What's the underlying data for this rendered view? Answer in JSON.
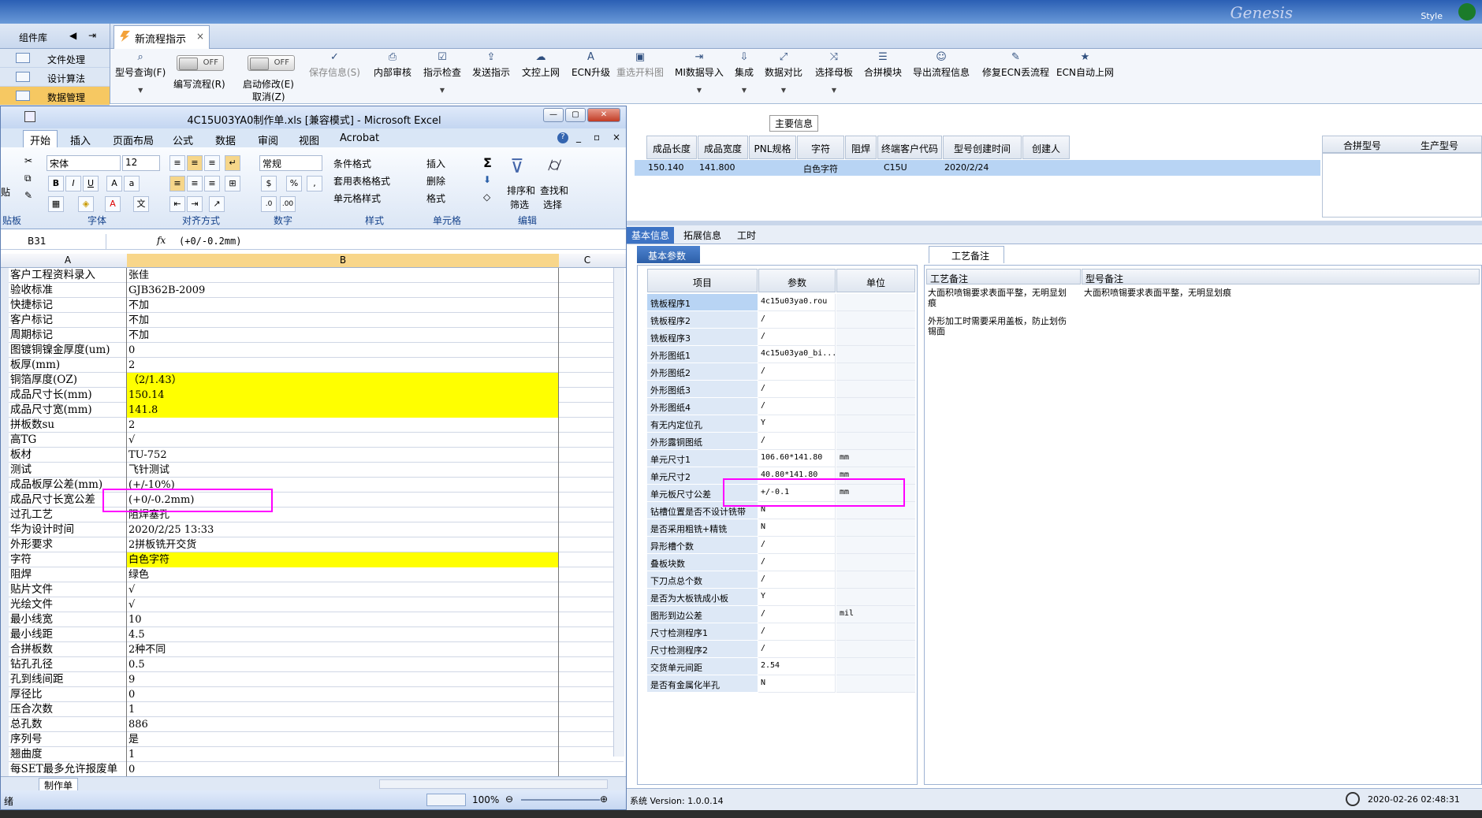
{
  "app": {
    "tab_title": "新流程指示",
    "close_glyph": "×",
    "style_label": "Style",
    "left_panel": {
      "title": "组件库",
      "items": [
        "文件处理",
        "设计算法",
        "数据管理"
      ]
    },
    "toolbar": {
      "buttons": [
        {
          "label": "型号查询(F)",
          "glyph": "⌕",
          "disabled": false
        },
        {
          "label": "保存信息(S)",
          "glyph": "✓",
          "disabled": true
        },
        {
          "label": "内部审核",
          "glyph": "⎙",
          "disabled": false
        },
        {
          "label": "指示检查",
          "glyph": "☑",
          "disabled": false
        },
        {
          "label": "发送指示",
          "glyph": "⇪",
          "disabled": false
        },
        {
          "label": "文控上网",
          "glyph": "☁",
          "disabled": false
        },
        {
          "label": "ECN升级",
          "glyph": "A",
          "disabled": false
        },
        {
          "label": "重选开料图",
          "glyph": "▣",
          "disabled": true
        },
        {
          "label": "MI数据导入",
          "glyph": "⇥",
          "disabled": false
        },
        {
          "label": "集成",
          "glyph": "⇩",
          "disabled": false
        },
        {
          "label": "数据对比",
          "glyph": "⤢",
          "disabled": false
        },
        {
          "label": "选择母板",
          "glyph": "⤨",
          "disabled": false
        },
        {
          "label": "合拼模块",
          "glyph": "☰",
          "disabled": false
        },
        {
          "label": "导出流程信息",
          "glyph": "☺",
          "disabled": false
        },
        {
          "label": "修复ECN丢流程",
          "glyph": "✎",
          "disabled": false
        },
        {
          "label": "ECN自动上网",
          "glyph": "★",
          "disabled": false
        }
      ],
      "toggle_off": "OFF",
      "toggle1_label": "编写流程(R)",
      "toggle2_label": "启动修改(E)",
      "toggle2_sub": "取消(Z)"
    },
    "main_info": {
      "title": "主要信息",
      "headers": [
        "成品长度",
        "成品宽度",
        "PNL规格",
        "字符",
        "阻焊",
        "终端客户代码",
        "型号创建时间",
        "创建人"
      ],
      "row": [
        "150.140",
        "141.800",
        "",
        "白色字符",
        "",
        "C15U",
        "2020/2/24",
        ""
      ],
      "right_headers": [
        "合拼型号",
        "生产型号"
      ]
    },
    "sub_tabs": [
      "基本信息",
      "拓展信息",
      "工时"
    ],
    "basic_params": {
      "tab": "基本参数",
      "headers": [
        "项目",
        "参数",
        "单位"
      ],
      "rows": [
        [
          "铣板程序1",
          "4c15u03ya0.rou",
          ""
        ],
        [
          "铣板程序2",
          "/",
          ""
        ],
        [
          "铣板程序3",
          "/",
          ""
        ],
        [
          "外形图纸1",
          "4c15u03ya0_bi...",
          ""
        ],
        [
          "外形图纸2",
          "/",
          ""
        ],
        [
          "外形图纸3",
          "/",
          ""
        ],
        [
          "外形图纸4",
          "/",
          ""
        ],
        [
          "有无内定位孔",
          "Y",
          ""
        ],
        [
          "外形露铜图纸",
          "/",
          ""
        ],
        [
          "单元尺寸1",
          "106.60*141.80",
          "mm"
        ],
        [
          "单元尺寸2",
          "40.80*141.80",
          "mm"
        ],
        [
          "单元板尺寸公差",
          "+/-0.1",
          "mm"
        ],
        [
          "钻槽位置是否不设计铣带",
          "N",
          ""
        ],
        [
          "是否采用粗铣+精铣",
          "N",
          ""
        ],
        [
          "异形槽个数",
          "/",
          ""
        ],
        [
          "叠板块数",
          "/",
          ""
        ],
        [
          "下刀点总个数",
          "/",
          ""
        ],
        [
          "是否为大板铣成小板",
          "Y",
          ""
        ],
        [
          "图形到边公差",
          "/",
          "mil"
        ],
        [
          "尺寸检测程序1",
          "/",
          ""
        ],
        [
          "尺寸检测程序2",
          "/",
          ""
        ],
        [
          "交货单元间距",
          "2.54",
          ""
        ],
        [
          "是否有金属化半孔",
          "N",
          ""
        ]
      ]
    },
    "process_notes": {
      "tab": "工艺备注",
      "col1": "工艺备注",
      "col2": "型号备注",
      "text1a": "大面积喷锡要求表面平整，无明显划痕",
      "text1b": "外形加工时需要采用盖板，防止划伤锡面",
      "text2": "大面积喷锡要求表面平整，无明显划痕"
    },
    "status": {
      "version": "系统 Version: 1.0.0.14",
      "time": "2020-02-26 02:48:31"
    }
  },
  "excel": {
    "title": "4C15U03YA0制作单.xls  [兼容模式] - Microsoft Excel",
    "tabs": [
      "开始",
      "插入",
      "页面布局",
      "公式",
      "数据",
      "审阅",
      "视图",
      "Acrobat"
    ],
    "ribbon": {
      "paste": "贴",
      "font_name": "宋体",
      "font_size": "12",
      "number_format": "常规",
      "cond_fmt": "条件格式",
      "table_fmt": "套用表格格式",
      "cell_style": "单元格样式",
      "insert": "插入",
      "delete": "删除",
      "format": "格式",
      "sort": "排序和",
      "sort2": "筛选",
      "find": "查找和",
      "find2": "选择",
      "groups": [
        "贴板",
        "字体",
        "对齐方式",
        "数字",
        "样式",
        "单元格",
        "编辑"
      ]
    },
    "name_box": "B31",
    "formula": "(+0/-0.2mm)",
    "col_headers": [
      "A",
      "B",
      "C"
    ],
    "rows": [
      [
        "客户工程资料录入",
        "张佳",
        false
      ],
      [
        "验收标准",
        "GJB362B-2009",
        false
      ],
      [
        "快捷标记",
        "不加",
        false
      ],
      [
        "客户标记",
        "不加",
        false
      ],
      [
        "周期标记",
        "不加",
        false
      ],
      [
        "图镀铜镍金厚度(um)",
        "0",
        false
      ],
      [
        "板厚(mm)",
        "2",
        false
      ],
      [
        "铜箔厚度(OZ)",
        "（2/1.43）",
        true
      ],
      [
        "成品尺寸长(mm)",
        "150.14",
        true
      ],
      [
        "成品尺寸宽(mm)",
        "141.8",
        true
      ],
      [
        "拼板数su",
        "2",
        false
      ],
      [
        "高TG",
        "√",
        false
      ],
      [
        "板材",
        "TU-752",
        false
      ],
      [
        "测试",
        "飞针测试",
        false
      ],
      [
        "成品板厚公差(mm)",
        "(+/-10%)",
        false
      ],
      [
        "成品尺寸长宽公差",
        "(+0/-0.2mm)",
        false
      ],
      [
        "过孔工艺",
        "阻焊塞孔",
        false
      ],
      [
        "华为设计时间",
        "2020/2/25 13:33",
        false
      ],
      [
        "外形要求",
        "2拼板铣开交货",
        false
      ],
      [
        "字符",
        "白色字符",
        true
      ],
      [
        "阻焊",
        "绿色",
        false
      ],
      [
        "贴片文件",
        "√",
        false
      ],
      [
        "光绘文件",
        "√",
        false
      ],
      [
        "最小线宽",
        "10",
        false
      ],
      [
        "最小线距",
        "4.5",
        false
      ],
      [
        "合拼板数",
        "2种不同",
        false
      ],
      [
        "钻孔孔径",
        "0.5",
        false
      ],
      [
        "孔到线间距",
        "9",
        false
      ],
      [
        "厚径比",
        "0",
        false
      ],
      [
        "压合次数",
        "1",
        false
      ],
      [
        "总孔数",
        "886",
        false
      ],
      [
        "序列号",
        "是",
        false
      ],
      [
        "翘曲度",
        "1",
        false
      ],
      [
        "每SET最多允许报废单",
        "0",
        false
      ]
    ],
    "sheet_tab": "制作单",
    "zoom": "100%",
    "status_text": "绪"
  }
}
